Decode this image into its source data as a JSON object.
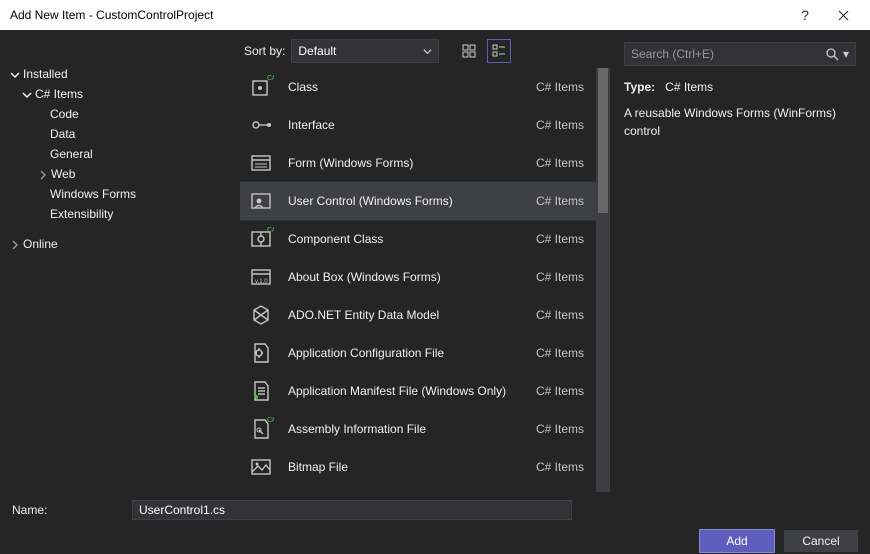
{
  "title": "Add New Item - CustomControlProject",
  "tree": {
    "installed": "Installed",
    "csitems": "C# Items",
    "online": "Online",
    "children": [
      "Code",
      "Data",
      "General",
      "Web",
      "Windows Forms",
      "Extensibility"
    ]
  },
  "sort": {
    "label": "Sort by:",
    "value": "Default"
  },
  "items": [
    {
      "label": "Class",
      "cat": "C# Items",
      "icon": "class"
    },
    {
      "label": "Interface",
      "cat": "C# Items",
      "icon": "interface"
    },
    {
      "label": "Form (Windows Forms)",
      "cat": "C# Items",
      "icon": "form"
    },
    {
      "label": "User Control (Windows Forms)",
      "cat": "C# Items",
      "icon": "usercontrol",
      "selected": true
    },
    {
      "label": "Component Class",
      "cat": "C# Items",
      "icon": "component"
    },
    {
      "label": "About Box (Windows Forms)",
      "cat": "C# Items",
      "icon": "about"
    },
    {
      "label": "ADO.NET Entity Data Model",
      "cat": "C# Items",
      "icon": "ado"
    },
    {
      "label": "Application Configuration File",
      "cat": "C# Items",
      "icon": "config"
    },
    {
      "label": "Application Manifest File (Windows Only)",
      "cat": "C# Items",
      "icon": "manifest"
    },
    {
      "label": "Assembly Information File",
      "cat": "C# Items",
      "icon": "assembly"
    },
    {
      "label": "Bitmap File",
      "cat": "C# Items",
      "icon": "bitmap"
    }
  ],
  "search": {
    "placeholder": "Search (Ctrl+E)"
  },
  "info": {
    "type_label": "Type:",
    "type_value": "C# Items",
    "description": "A reusable Windows Forms (WinForms) control"
  },
  "footer": {
    "name_label": "Name:",
    "name_value": "UserControl1.cs",
    "add": "Add",
    "cancel": "Cancel"
  }
}
